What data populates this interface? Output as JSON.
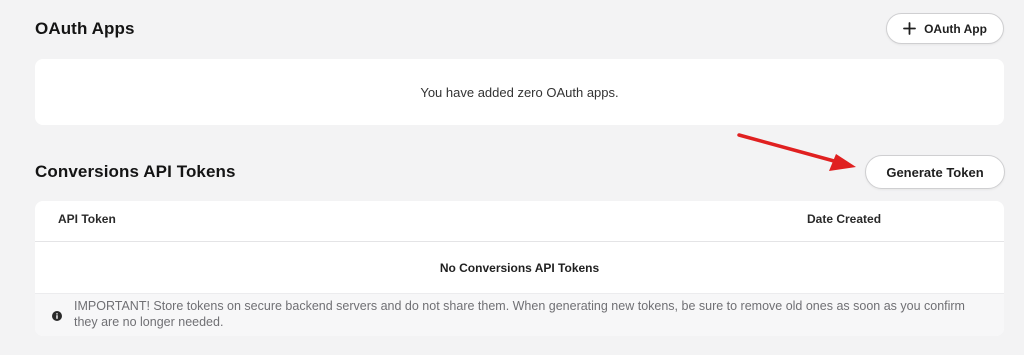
{
  "oauth": {
    "title": "OAuth Apps",
    "add_button_icon": "plus-icon",
    "add_button_label": "OAuth App",
    "empty_message": "You have added zero OAuth apps."
  },
  "conversions": {
    "title": "Conversions API Tokens",
    "generate_button_label": "Generate Token",
    "table": {
      "columns": [
        "API Token",
        "Date Created"
      ],
      "empty_message": "No Conversions API Tokens"
    },
    "notice": {
      "icon": "info-icon",
      "text": "IMPORTANT! Store tokens on secure backend servers and do not share them. When generating new tokens, be sure to remove old ones as soon as you confirm they are no longer needed."
    }
  },
  "annotation": {
    "icon": "red-arrow-icon",
    "color": "#e02020"
  }
}
